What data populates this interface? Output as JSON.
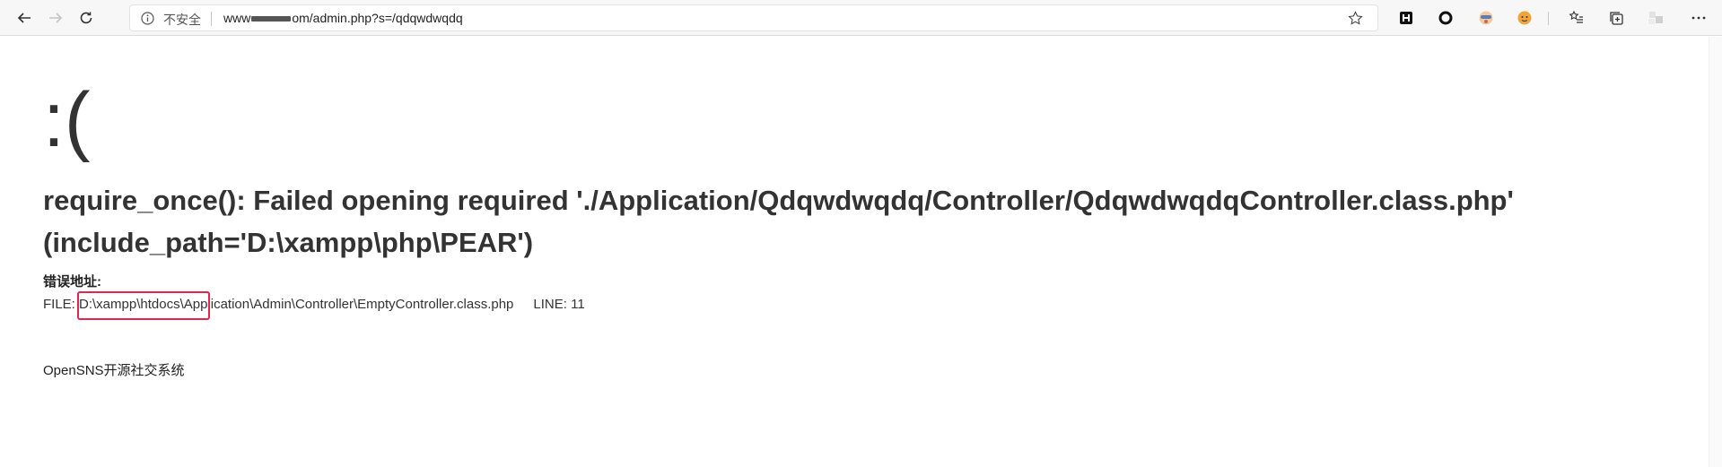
{
  "browser": {
    "security_label": "不安全",
    "url_prefix": "www",
    "url_suffix": "om/admin.php?s=/qdqwdwqdq"
  },
  "page": {
    "smiley": ":(",
    "error_message": "require_once(): Failed opening required './Application/Qdqwdwqdq/Controller/QdqwdwqdqController.class.php' (include_path='D:\\xampp\\php\\PEAR')",
    "location_label": "错误地址:",
    "file_label": "FILE: ",
    "file_path_highlighted": "D:\\xampp\\htdocs\\",
    "file_path_rest": "Application\\Admin\\Controller\\EmptyController.class.php",
    "line_label": "LINE: 11",
    "footer": "OpenSNS开源社交系统"
  },
  "colors": {
    "highlight_box": "#e4234f",
    "text": "#333333"
  }
}
